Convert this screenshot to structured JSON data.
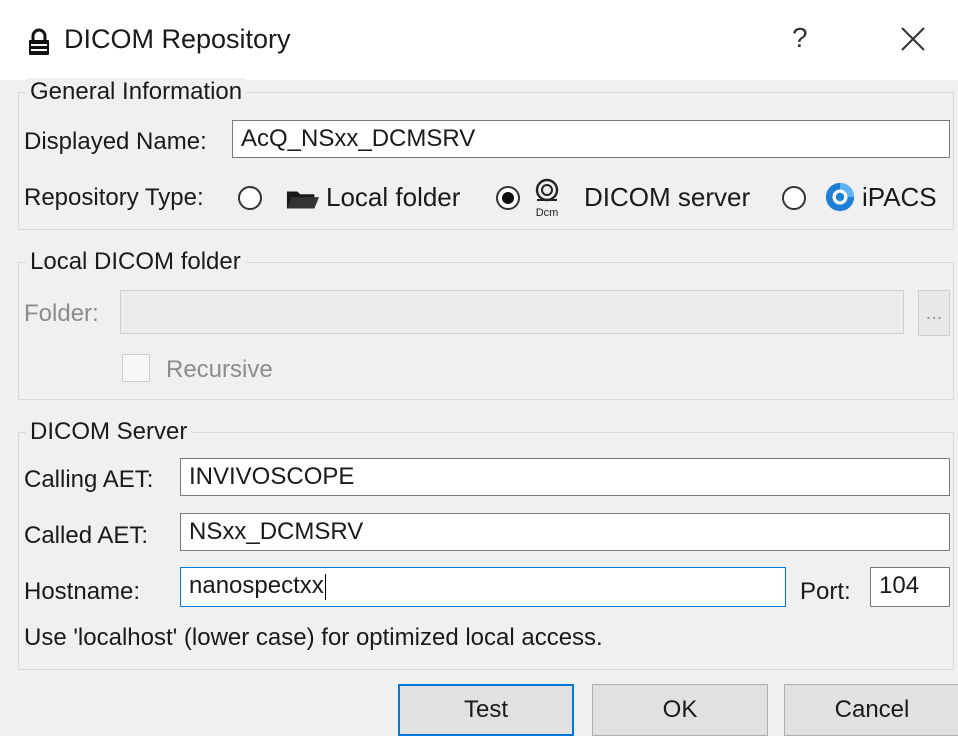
{
  "window": {
    "title": "DICOM Repository",
    "help_label": "?"
  },
  "general": {
    "group_title": "General Information",
    "displayed_name_label": "Displayed Name:",
    "displayed_name_value": "AcQ_NSxx_DCMSRV",
    "repo_type_label": "Repository Type:",
    "repo_options": [
      {
        "label": "Local folder",
        "icon": "folder-icon",
        "checked": false
      },
      {
        "label": "DICOM server",
        "icon": "dicom-server-icon",
        "checked": true
      },
      {
        "label": "iPACS",
        "icon": "ipacs-icon",
        "checked": false
      }
    ],
    "dcm_icon_text": "Dcm"
  },
  "local_folder": {
    "group_title": "Local DICOM folder",
    "folder_label": "Folder:",
    "folder_value": "",
    "browse_label": "...",
    "recursive_label": "Recursive",
    "recursive_checked": false
  },
  "server": {
    "group_title": "DICOM Server",
    "calling_aet_label": "Calling AET:",
    "calling_aet_value": "INVIVOSCOPE",
    "called_aet_label": "Called AET:",
    "called_aet_value": "NSxx_DCMSRV",
    "hostname_label": "Hostname:",
    "hostname_value": "nanospectxx",
    "port_label": "Port:",
    "port_value": "104",
    "hint": "Use 'localhost' (lower case) for optimized local access."
  },
  "buttons": {
    "test": "Test",
    "ok": "OK",
    "cancel": "Cancel"
  },
  "colors": {
    "accent": "#0078d7",
    "ipacs_blue": "#1e7fd6"
  }
}
